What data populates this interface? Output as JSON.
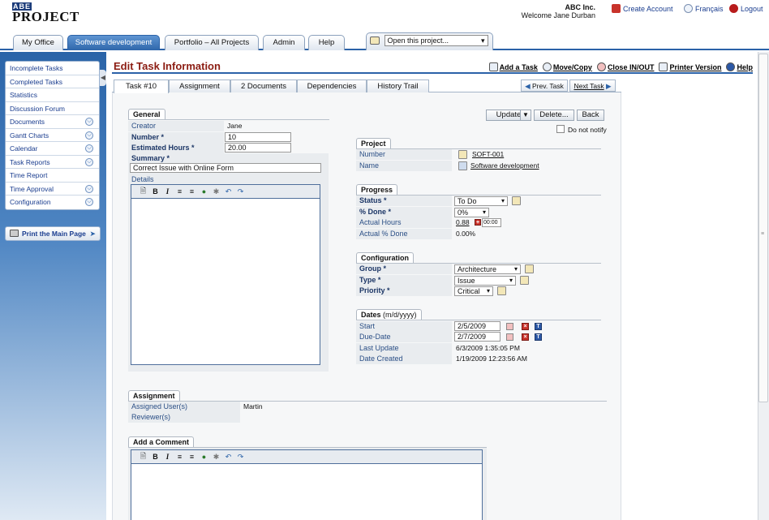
{
  "header": {
    "logo_small": "ABE",
    "logo_main": "PROJECT",
    "company": "ABC Inc.",
    "welcome": "Welcome Jane Durban",
    "links": {
      "create_account": "Create Account",
      "language": "Français",
      "logout": "Logout"
    }
  },
  "tabs": {
    "items": [
      "My Office",
      "Software development",
      "Portfolio – All Projects",
      "Admin",
      "Help"
    ],
    "active": "Software development",
    "open_project": "Open this project..."
  },
  "sidebar": {
    "items": [
      {
        "label": "Incomplete Tasks",
        "expandable": false
      },
      {
        "label": "Completed Tasks",
        "expandable": false
      },
      {
        "label": "Statistics",
        "expandable": false
      },
      {
        "label": "Discussion Forum",
        "expandable": false
      },
      {
        "label": "Documents",
        "expandable": true
      },
      {
        "label": "Gantt Charts",
        "expandable": true
      },
      {
        "label": "Calendar",
        "expandable": true
      },
      {
        "label": "Task Reports",
        "expandable": true
      },
      {
        "label": "Time Report",
        "expandable": false
      },
      {
        "label": "Time Approval",
        "expandable": true
      },
      {
        "label": "Configuration",
        "expandable": true
      }
    ],
    "print_main": "Print the Main Page"
  },
  "page": {
    "title": "Edit Task Information",
    "toolbar": {
      "add_task": "Add a Task",
      "move_copy": "Move/Copy",
      "close_in_out": "Close IN/OUT",
      "printer_version": "Printer Version",
      "help": "Help"
    },
    "subtabs": [
      "Task #10",
      "Assignment",
      "2 Documents",
      "Dependencies",
      "History Trail"
    ],
    "prev_task": "Prev. Task",
    "next_task": "Next Task"
  },
  "general": {
    "title": "General",
    "creator_label": "Creator",
    "creator_value": "Jane",
    "number_label": "Number *",
    "number_value": "10",
    "hours_label": "Estimated Hours *",
    "hours_value": "20.00",
    "summary_label": "Summary *",
    "summary_value": "Correct Issue with Online Form",
    "details_label": "Details"
  },
  "actions": {
    "update": "Update",
    "delete": "Delete...",
    "back": "Back",
    "do_not_notify": "Do not notify"
  },
  "project": {
    "title": "Project",
    "number_label": "Number",
    "number_value": "SOFT-001",
    "name_label": "Name",
    "name_value": "Software development"
  },
  "progress": {
    "title": "Progress",
    "status_label": "Status *",
    "status_value": "To Do",
    "done_label": "% Done *",
    "done_value": "0%",
    "actual_hours_label": "Actual Hours",
    "actual_hours_value": "0.88",
    "actual_hours_time": "00:00",
    "actual_done_label": "Actual % Done",
    "actual_done_value": "0.00%"
  },
  "configuration": {
    "title": "Configuration",
    "group_label": "Group *",
    "group_value": "Architecture",
    "type_label": "Type *",
    "type_value": "Issue",
    "priority_label": "Priority *",
    "priority_value": "Critical"
  },
  "dates": {
    "title": "Dates",
    "format": "(m/d/yyyy)",
    "start_label": "Start",
    "start_value": "2/5/2009",
    "due_label": "Due-Date",
    "due_value": "2/7/2009",
    "last_update_label": "Last Update",
    "last_update_value": "6/3/2009 1:35:05 PM",
    "created_label": "Date Created",
    "created_value": "1/19/2009 12:23:56 AM"
  },
  "assignment": {
    "title": "Assignment",
    "users_label": "Assigned User(s)",
    "users_value": "Martin",
    "reviewers_label": "Reviewer(s)"
  },
  "comment": {
    "title": "Add a Comment"
  },
  "editor_toolbar": [
    "new-doc",
    "bold",
    "italic",
    "numbered-list",
    "bullet-list",
    "link",
    "spell-check",
    "undo",
    "redo"
  ],
  "colors": {
    "accent_blue": "#2b62a8",
    "title_red": "#8b1c12",
    "label_blue": "#2b4f86"
  }
}
